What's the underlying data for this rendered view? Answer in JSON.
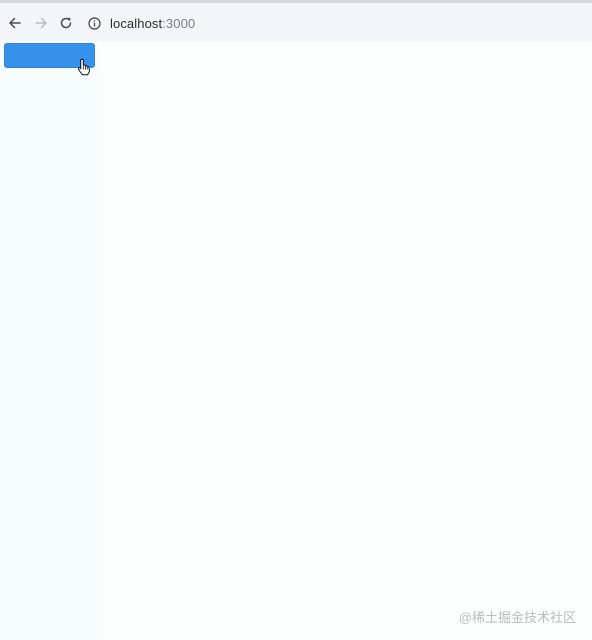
{
  "browser": {
    "url_host": "localhost",
    "url_port": ":3000",
    "icons": {
      "back": "arrow-left-icon",
      "forward": "arrow-right-icon",
      "reload": "reload-icon",
      "site_info": "info-circle-icon"
    }
  },
  "main": {
    "button_label": "",
    "button_color": "#3591ea",
    "cursor": "hand-pointer-icon"
  },
  "watermark": {
    "text": "@稀土掘金技术社区"
  }
}
